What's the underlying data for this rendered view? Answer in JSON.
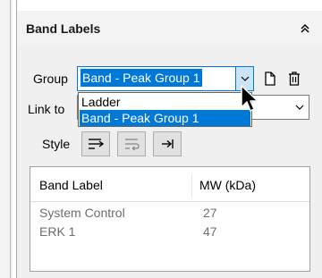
{
  "panel": {
    "title": "Band Labels",
    "collapse_icon": "chevron-double-up-icon"
  },
  "group": {
    "label": "Group",
    "value": "Band - Peak Group 1",
    "dropdown_options": [
      "Ladder",
      "Band - Peak Group 1"
    ],
    "selected_option": "Band - Peak Group 1",
    "new_icon": "new-document-icon",
    "delete_icon": "trash-icon"
  },
  "link_to": {
    "label": "Link to",
    "value": ""
  },
  "style": {
    "label": "Style",
    "buttons": [
      "wrap-arrow-icon",
      "text-wrap-icon",
      "tab-arrow-icon"
    ]
  },
  "table": {
    "columns": [
      "Band Label",
      "MW (kDa)"
    ],
    "rows": [
      [
        "System Control",
        "27"
      ],
      [
        "ERK 1",
        "47"
      ]
    ]
  },
  "colors": {
    "accent": "#0078d7",
    "header_bg": "#f3f3f3",
    "content_bg": "#f0f0f0",
    "muted_text": "#6d6d6d"
  }
}
